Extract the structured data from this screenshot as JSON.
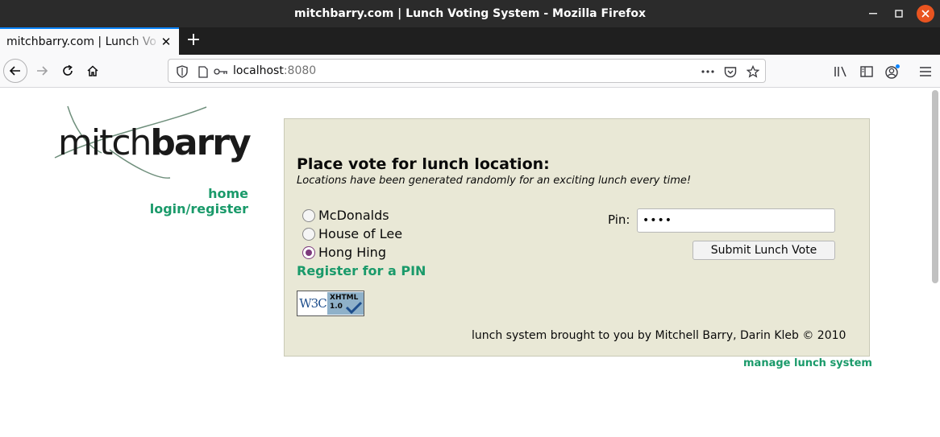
{
  "window": {
    "title": "mitchbarry.com | Lunch Voting System - Mozilla Firefox"
  },
  "tabs": [
    {
      "label": "mitchbarry.com | Lunch Voting System"
    }
  ],
  "urlbar": {
    "host": "localhost",
    "port": ":8080"
  },
  "logo": {
    "text_light": "mitch",
    "text_bold": "barry"
  },
  "sidebar": {
    "links": [
      "home",
      "login/register"
    ]
  },
  "vote": {
    "heading": "Place vote for lunch location:",
    "subheading": "Locations have been generated randomly for an exciting lunch every time!",
    "options": [
      {
        "label": "McDonalds",
        "selected": false
      },
      {
        "label": "House of Lee",
        "selected": false
      },
      {
        "label": "Hong Hing",
        "selected": true
      }
    ],
    "register_link": "Register for a PIN",
    "pin_label": "Pin:",
    "pin_value": "••••",
    "submit_label": "Submit Lunch Vote",
    "badge": {
      "left": "W3C",
      "line1": "XHTML",
      "line2": "1.0"
    },
    "footer": "lunch system brought to you by Mitchell Barry, Darin Kleb © 2010"
  },
  "manage_link": "manage lunch system",
  "colors": {
    "link": "#1a9a6a",
    "panel": "#e9e8d6",
    "radio_checked": "#7d3a7c",
    "tab_accent": "#0a84ff"
  }
}
